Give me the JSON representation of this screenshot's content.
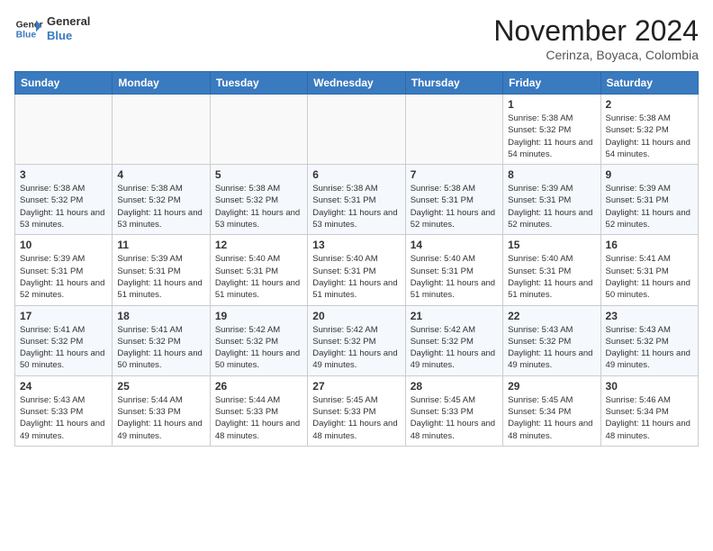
{
  "header": {
    "logo_line1": "General",
    "logo_line2": "Blue",
    "month": "November 2024",
    "location": "Cerinza, Boyaca, Colombia"
  },
  "weekdays": [
    "Sunday",
    "Monday",
    "Tuesday",
    "Wednesday",
    "Thursday",
    "Friday",
    "Saturday"
  ],
  "weeks": [
    [
      {
        "day": "",
        "empty": true
      },
      {
        "day": "",
        "empty": true
      },
      {
        "day": "",
        "empty": true
      },
      {
        "day": "",
        "empty": true
      },
      {
        "day": "",
        "empty": true
      },
      {
        "day": "1",
        "sunrise": "5:38 AM",
        "sunset": "5:32 PM",
        "daylight": "11 hours and 54 minutes."
      },
      {
        "day": "2",
        "sunrise": "5:38 AM",
        "sunset": "5:32 PM",
        "daylight": "11 hours and 54 minutes."
      }
    ],
    [
      {
        "day": "3",
        "sunrise": "5:38 AM",
        "sunset": "5:32 PM",
        "daylight": "11 hours and 53 minutes."
      },
      {
        "day": "4",
        "sunrise": "5:38 AM",
        "sunset": "5:32 PM",
        "daylight": "11 hours and 53 minutes."
      },
      {
        "day": "5",
        "sunrise": "5:38 AM",
        "sunset": "5:32 PM",
        "daylight": "11 hours and 53 minutes."
      },
      {
        "day": "6",
        "sunrise": "5:38 AM",
        "sunset": "5:31 PM",
        "daylight": "11 hours and 53 minutes."
      },
      {
        "day": "7",
        "sunrise": "5:38 AM",
        "sunset": "5:31 PM",
        "daylight": "11 hours and 52 minutes."
      },
      {
        "day": "8",
        "sunrise": "5:39 AM",
        "sunset": "5:31 PM",
        "daylight": "11 hours and 52 minutes."
      },
      {
        "day": "9",
        "sunrise": "5:39 AM",
        "sunset": "5:31 PM",
        "daylight": "11 hours and 52 minutes."
      }
    ],
    [
      {
        "day": "10",
        "sunrise": "5:39 AM",
        "sunset": "5:31 PM",
        "daylight": "11 hours and 52 minutes."
      },
      {
        "day": "11",
        "sunrise": "5:39 AM",
        "sunset": "5:31 PM",
        "daylight": "11 hours and 51 minutes."
      },
      {
        "day": "12",
        "sunrise": "5:40 AM",
        "sunset": "5:31 PM",
        "daylight": "11 hours and 51 minutes."
      },
      {
        "day": "13",
        "sunrise": "5:40 AM",
        "sunset": "5:31 PM",
        "daylight": "11 hours and 51 minutes."
      },
      {
        "day": "14",
        "sunrise": "5:40 AM",
        "sunset": "5:31 PM",
        "daylight": "11 hours and 51 minutes."
      },
      {
        "day": "15",
        "sunrise": "5:40 AM",
        "sunset": "5:31 PM",
        "daylight": "11 hours and 51 minutes."
      },
      {
        "day": "16",
        "sunrise": "5:41 AM",
        "sunset": "5:31 PM",
        "daylight": "11 hours and 50 minutes."
      }
    ],
    [
      {
        "day": "17",
        "sunrise": "5:41 AM",
        "sunset": "5:32 PM",
        "daylight": "11 hours and 50 minutes."
      },
      {
        "day": "18",
        "sunrise": "5:41 AM",
        "sunset": "5:32 PM",
        "daylight": "11 hours and 50 minutes."
      },
      {
        "day": "19",
        "sunrise": "5:42 AM",
        "sunset": "5:32 PM",
        "daylight": "11 hours and 50 minutes."
      },
      {
        "day": "20",
        "sunrise": "5:42 AM",
        "sunset": "5:32 PM",
        "daylight": "11 hours and 49 minutes."
      },
      {
        "day": "21",
        "sunrise": "5:42 AM",
        "sunset": "5:32 PM",
        "daylight": "11 hours and 49 minutes."
      },
      {
        "day": "22",
        "sunrise": "5:43 AM",
        "sunset": "5:32 PM",
        "daylight": "11 hours and 49 minutes."
      },
      {
        "day": "23",
        "sunrise": "5:43 AM",
        "sunset": "5:32 PM",
        "daylight": "11 hours and 49 minutes."
      }
    ],
    [
      {
        "day": "24",
        "sunrise": "5:43 AM",
        "sunset": "5:33 PM",
        "daylight": "11 hours and 49 minutes."
      },
      {
        "day": "25",
        "sunrise": "5:44 AM",
        "sunset": "5:33 PM",
        "daylight": "11 hours and 49 minutes."
      },
      {
        "day": "26",
        "sunrise": "5:44 AM",
        "sunset": "5:33 PM",
        "daylight": "11 hours and 48 minutes."
      },
      {
        "day": "27",
        "sunrise": "5:45 AM",
        "sunset": "5:33 PM",
        "daylight": "11 hours and 48 minutes."
      },
      {
        "day": "28",
        "sunrise": "5:45 AM",
        "sunset": "5:33 PM",
        "daylight": "11 hours and 48 minutes."
      },
      {
        "day": "29",
        "sunrise": "5:45 AM",
        "sunset": "5:34 PM",
        "daylight": "11 hours and 48 minutes."
      },
      {
        "day": "30",
        "sunrise": "5:46 AM",
        "sunset": "5:34 PM",
        "daylight": "11 hours and 48 minutes."
      }
    ]
  ],
  "labels": {
    "sunrise": "Sunrise:",
    "sunset": "Sunset:",
    "daylight": "Daylight:"
  }
}
